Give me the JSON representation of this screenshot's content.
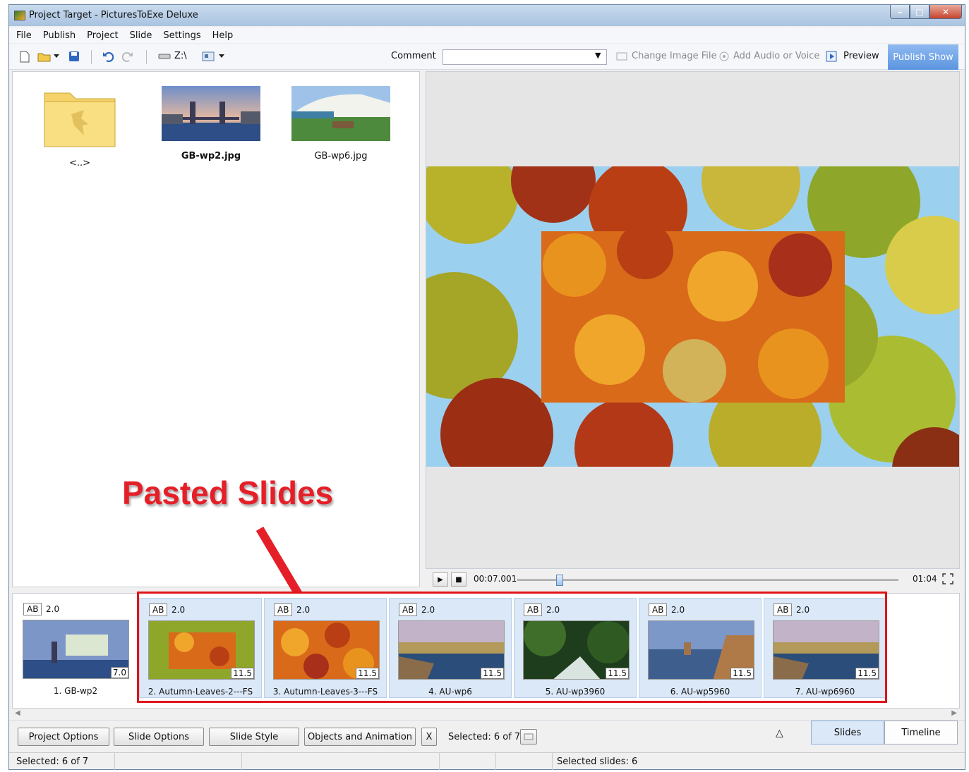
{
  "window": {
    "title": "Project Target - PicturesToExe Deluxe"
  },
  "menu": [
    "File",
    "Publish",
    "Project",
    "Slide",
    "Settings",
    "Help"
  ],
  "toolbar": {
    "drive": "Z:\\",
    "comment_label": "Comment",
    "comment_value": "",
    "change_image": "Change Image File",
    "add_audio": "Add Audio or Voice",
    "preview": "Preview",
    "publish": "Publish Show"
  },
  "browser": {
    "files": [
      {
        "name": "<..>",
        "type": "folder"
      },
      {
        "name": "GB-wp2.jpg",
        "type": "image"
      },
      {
        "name": "GB-wp6.jpg",
        "type": "image"
      }
    ]
  },
  "player": {
    "current_time": "00:07.001",
    "total_time": "01:04",
    "progress": 0.11
  },
  "annotation": {
    "text": "Pasted Slides"
  },
  "slides": [
    {
      "label": "1. GB-wp2",
      "transition": "AB",
      "transition_duration": "2.0",
      "duration": "7.0",
      "selected": false
    },
    {
      "label": "2. Autumn-Leaves-2---FS",
      "transition": "AB",
      "transition_duration": "2.0",
      "duration": "11.5",
      "selected": true
    },
    {
      "label": "3. Autumn-Leaves-3---FS",
      "transition": "AB",
      "transition_duration": "2.0",
      "duration": "11.5",
      "selected": true
    },
    {
      "label": "4. AU-wp6",
      "transition": "AB",
      "transition_duration": "2.0",
      "duration": "11.5",
      "selected": true
    },
    {
      "label": "5. AU-wp3960",
      "transition": "AB",
      "transition_duration": "2.0",
      "duration": "11.5",
      "selected": true
    },
    {
      "label": "6. AU-wp5960",
      "transition": "AB",
      "transition_duration": "2.0",
      "duration": "11.5",
      "selected": true
    },
    {
      "label": "7. AU-wp6960",
      "transition": "AB",
      "transition_duration": "2.0",
      "duration": "11.5",
      "selected": true
    }
  ],
  "bottom": {
    "project_options": "Project Options",
    "slide_options": "Slide Options",
    "slide_style": "Slide Style",
    "objects_animation": "Objects and Animation",
    "clear": "X",
    "selected": "Selected: 6 of 7",
    "tab_slides": "Slides",
    "tab_timeline": "Timeline",
    "collapse": "△"
  },
  "status": {
    "left": "Selected: 6 of 7",
    "right": "Selected slides: 6"
  }
}
